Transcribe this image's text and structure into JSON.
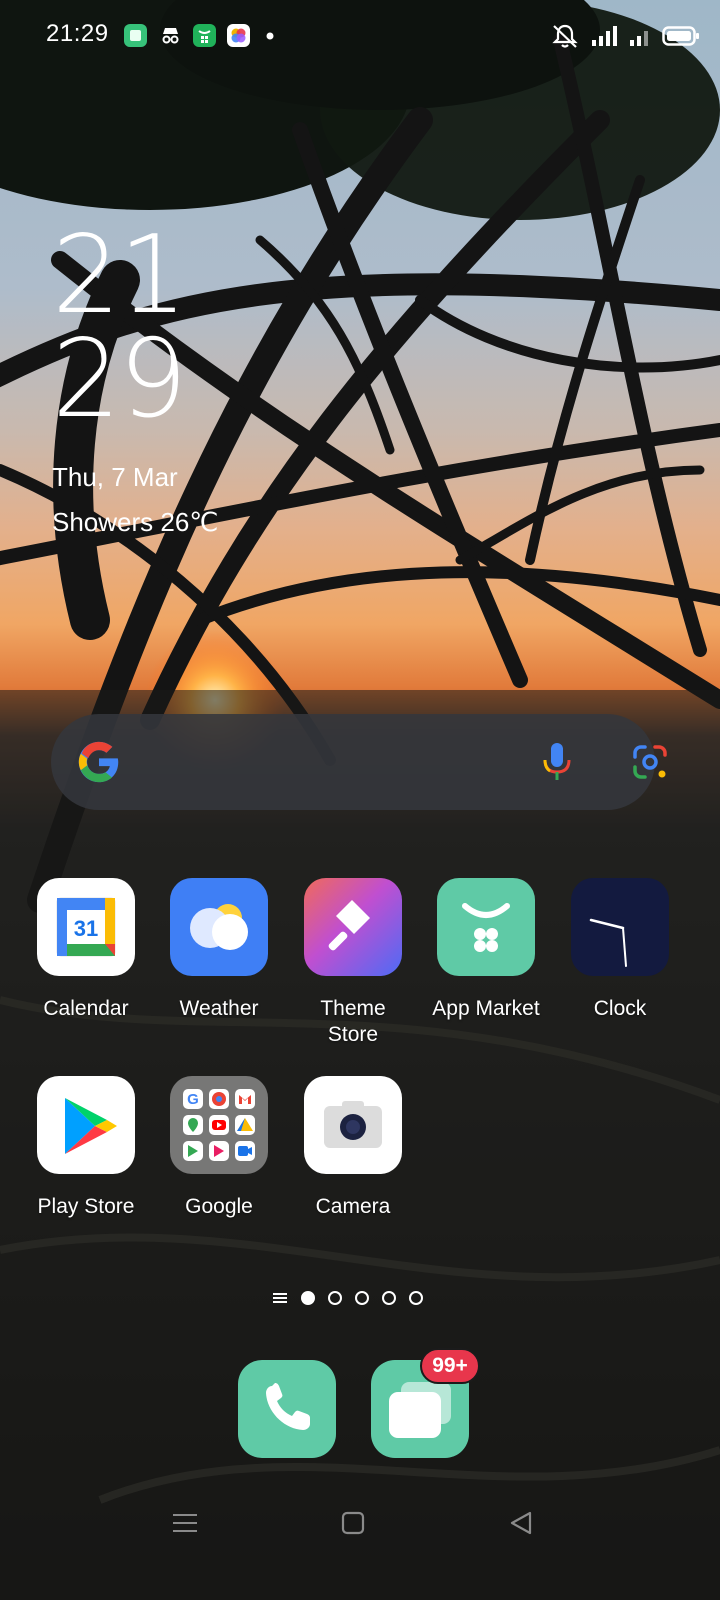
{
  "status_bar": {
    "time": "21:29",
    "notification_icons": [
      "green-square-app-icon",
      "incognito-icon",
      "app-market-icon",
      "photos-app-icon",
      "more-dot-icon"
    ],
    "right_icons": [
      "mute-bell-icon",
      "signal-icon",
      "signal-2-icon",
      "battery-icon"
    ]
  },
  "clock_widget": {
    "hour": "21",
    "minute": "29",
    "date": "Thu, 7 Mar",
    "weather": "Showers 26℃"
  },
  "search_bar": {
    "icons": [
      "google-g-icon",
      "microphone-icon",
      "google-lens-icon"
    ]
  },
  "apps": [
    {
      "label": "Calendar",
      "icon": "calendar-icon",
      "day": "31"
    },
    {
      "label": "Weather",
      "icon": "weather-icon"
    },
    {
      "label": "Theme\nStore",
      "icon": "theme-store-icon"
    },
    {
      "label": "App Market",
      "icon": "app-market-icon"
    },
    {
      "label": "Clock",
      "icon": "clock-icon"
    },
    {
      "label": "Play Store",
      "icon": "play-store-icon"
    },
    {
      "label": "Google",
      "icon": "google-folder-icon"
    },
    {
      "label": "Camera",
      "icon": "camera-icon"
    }
  ],
  "page_indicator": {
    "pages": 5,
    "active": 1
  },
  "dock": {
    "phone_icon": "phone-icon",
    "messages_icon": "messages-icon",
    "messages_badge": "99+"
  },
  "nav_bar": {
    "icons": [
      "recents-menu-icon",
      "home-square-icon",
      "back-triangle-icon"
    ]
  },
  "colors": {
    "dock_green": "#5fcaa6",
    "badge_red": "#e8364c",
    "weather_blue": "#3f7ff5",
    "clock_navy": "#131a3f"
  }
}
